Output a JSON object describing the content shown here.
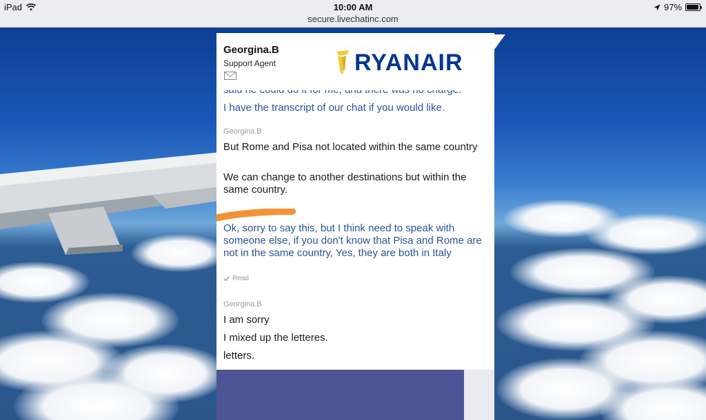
{
  "status_bar": {
    "device": "iPad",
    "time": "10:00 AM",
    "url": "secure.livechatinc.com",
    "battery": "97%",
    "battery_level": 0.97
  },
  "chat": {
    "agent_name": "Georgina.B",
    "agent_role": "Support Agent",
    "logo_text": "RYANAIR",
    "messages": {
      "m0_cut": "said he could do it for me, and there was no charge.",
      "m0_line": "I have the transcript of our chat if you would like.",
      "sender1": "Georgina.B",
      "m1a": "But Rome and Pisa not located within the same country",
      "m1b": "We can change to another destinations but within the same country.",
      "m2": "Ok, sorry to say this, but I think need to speak with someone else, if you don't know that Pisa and Rome are not in the same country, Yes, they are both in Italy",
      "read": "Read",
      "sender2": "Georgina.B",
      "m3a": "I am sorry",
      "m3b": "I mixed up the letteres.",
      "m3c": "letters."
    }
  },
  "colors": {
    "brand": "#073590",
    "user_text": "#2a5297",
    "footer": "#4c5496",
    "redaction": "#f39235"
  }
}
